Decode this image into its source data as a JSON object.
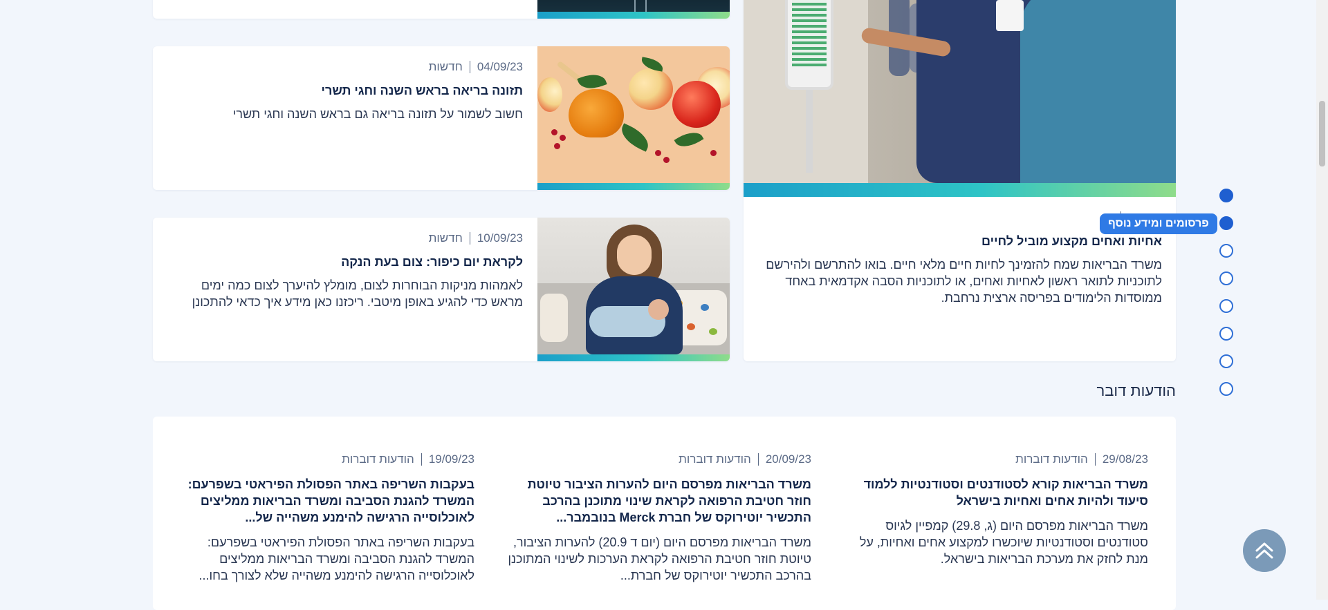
{
  "top_article": {
    "image_desc": "partial-glass"
  },
  "articles": [
    {
      "date": "04/09/23",
      "category": "חדשות",
      "title": "תזונה בריאה בראש השנה וחגי תשרי",
      "desc": "חשוב לשמור על תזונה בריאה גם בראש השנה וחגי תשרי"
    },
    {
      "date": "10/09/23",
      "category": "חדשות",
      "title": "לקראת יום כיפור: צום בעת הנקה",
      "desc": "לאמהות מניקות הבוחרות לצום, מומלץ להיערך לצום כמה ימים מראש כדי להגיע באופן מיטבי. ריכזנו כאן מידע איך כדאי להתכונן"
    }
  ],
  "featured": {
    "category": "חדשות",
    "title": "אחיות ואחים מקצוע מוביל לחיים",
    "desc": "משרד הבריאות שמח להזמינך לחיות חיים מלאי חיים. בואו להתרשם ולהירשם לתוכניות לתואר ראשון לאחיות ואחים, או לתוכניות הסבה אקדמאית באחד ממוסדות הלימודים בפריסה ארצית נרחבת."
  },
  "dot_nav": {
    "tooltip": "פרסומים ומידע נוסף",
    "active_index": 1,
    "count": 8
  },
  "section_heading": "הודעות דובר",
  "announcements": [
    {
      "date": "29/08/23",
      "category": "הודעות דוברות",
      "title": "משרד הבריאות קורא לסטודנטים וסטודנטיות ללמוד סיעוד ולהיות אחים ואחיות בישראל",
      "desc": "משרד הבריאות מפרסם היום (ג, 29.8) קמפיין לגיוס סטודנטים וסטודנטיות שיוכשרו למקצוע אחים ואחיות, על מנת לחזק את מערכת הבריאות בישראל."
    },
    {
      "date": "20/09/23",
      "category": "הודעות דוברות",
      "title": "משרד הבריאות מפרסם היום להערות הציבור טיוטת חוזר חטיבת הרפואה לקראת שינוי מתוכנן בהרכב התכשיר יוטירוקס של חברת Merck בנובמבר...",
      "desc": "משרד הבריאות מפרסם היום (יום ד 20.9) להערות הציבור, טיוטת חוזר חטיבת הרפואה לקראת הערכות לשינוי המתוכנן בהרכב התכשיר יוטירוקס של חברת..."
    },
    {
      "date": "19/09/23",
      "category": "הודעות דוברות",
      "title": "בעקבות השריפה באתר הפסולת הפיראטי בשפרעם: המשרד להגנת הסביבה ומשרד הבריאות ממליצים לאוכלוסייה הרגישה להימנע משהייה של...",
      "desc": "בעקבות השריפה באתר הפסולת הפיראטי בשפרעם: המשרד להגנת הסביבה ומשרד הבריאות ממליצים לאוכלוסייה הרגישה להימנע משהייה שלא לצורך בחו..."
    }
  ],
  "colors": {
    "accent": "#1f5fd0",
    "tooltip": "#2f7ae5",
    "scroll_top": "#7b9ab8",
    "page_bg": "#f2f6fc"
  }
}
